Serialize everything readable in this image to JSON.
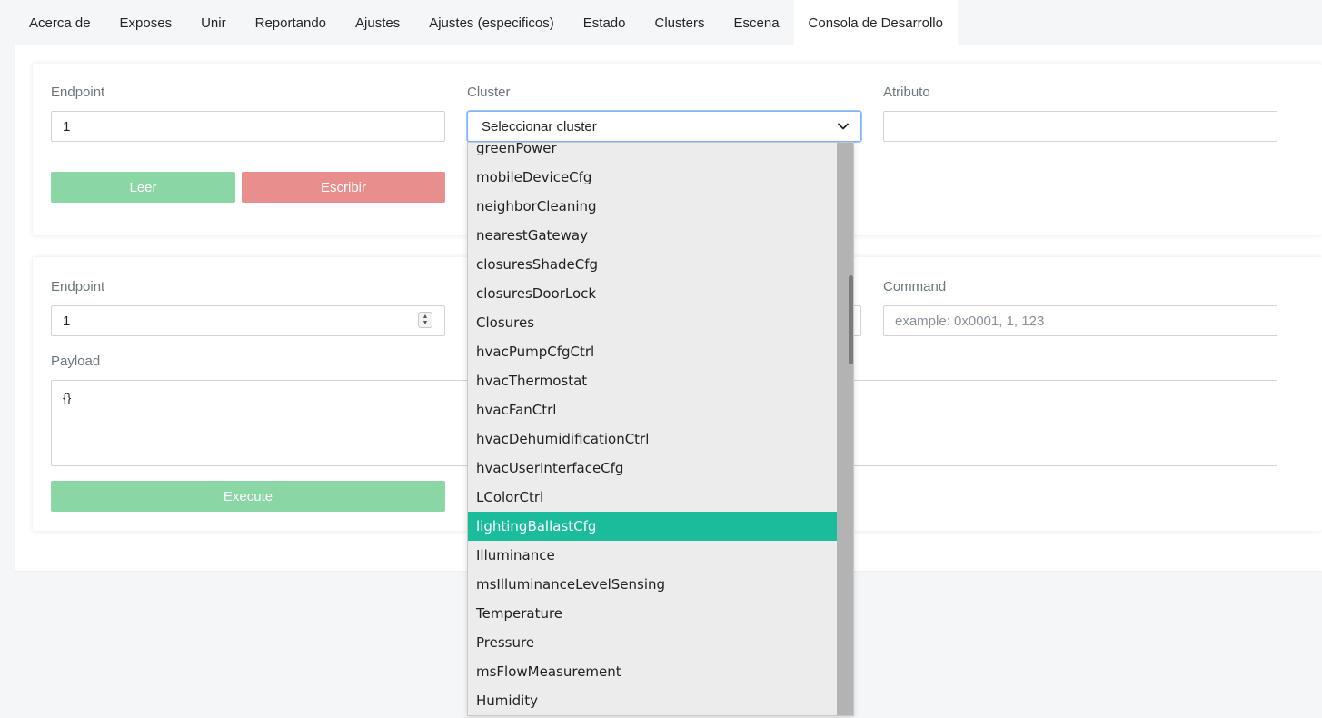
{
  "tabs": [
    {
      "label": "Acerca de"
    },
    {
      "label": "Exposes"
    },
    {
      "label": "Unir"
    },
    {
      "label": "Reportando"
    },
    {
      "label": "Ajustes"
    },
    {
      "label": "Ajustes (especificos)"
    },
    {
      "label": "Estado"
    },
    {
      "label": "Clusters"
    },
    {
      "label": "Escena"
    },
    {
      "label": "Consola de Desarrollo"
    }
  ],
  "active_tab": "Consola de Desarrollo",
  "read_write": {
    "endpoint_label": "Endpoint",
    "endpoint_value": "1",
    "cluster_label": "Cluster",
    "cluster_select_text": "Seleccionar cluster",
    "attribute_label": "Atributo",
    "attribute_value": "",
    "read_button": "Leer",
    "write_button": "Escribir"
  },
  "command": {
    "endpoint_label": "Endpoint",
    "endpoint_value": "1",
    "command_label": "Command",
    "command_placeholder": "example: 0x0001, 1, 123",
    "payload_label": "Payload",
    "payload_value": "{}",
    "execute_button": "Execute"
  },
  "cluster_dropdown": {
    "items": [
      "greenPower",
      "mobileDeviceCfg",
      "neighborCleaning",
      "nearestGateway",
      "closuresShadeCfg",
      "closuresDoorLock",
      "Closures",
      "hvacPumpCfgCtrl",
      "hvacThermostat",
      "hvacFanCtrl",
      "hvacDehumidificationCtrl",
      "hvacUserInterfaceCfg",
      "LColorCtrl",
      "lightingBallastCfg",
      "Illuminance",
      "msIlluminanceLevelSensing",
      "Temperature",
      "Pressure",
      "msFlowMeasurement",
      "Humidity"
    ],
    "highlighted": "lightingBallastCfg",
    "highlight_color": "#1abc9c"
  },
  "colors": {
    "read_button": "#8ad6a5",
    "write_button": "#e88e8c",
    "execute_button": "#8ad6a5"
  },
  "icons": {
    "select_caret": "chevron-down-icon",
    "number_spinner": "spinner-arrows-icon"
  }
}
